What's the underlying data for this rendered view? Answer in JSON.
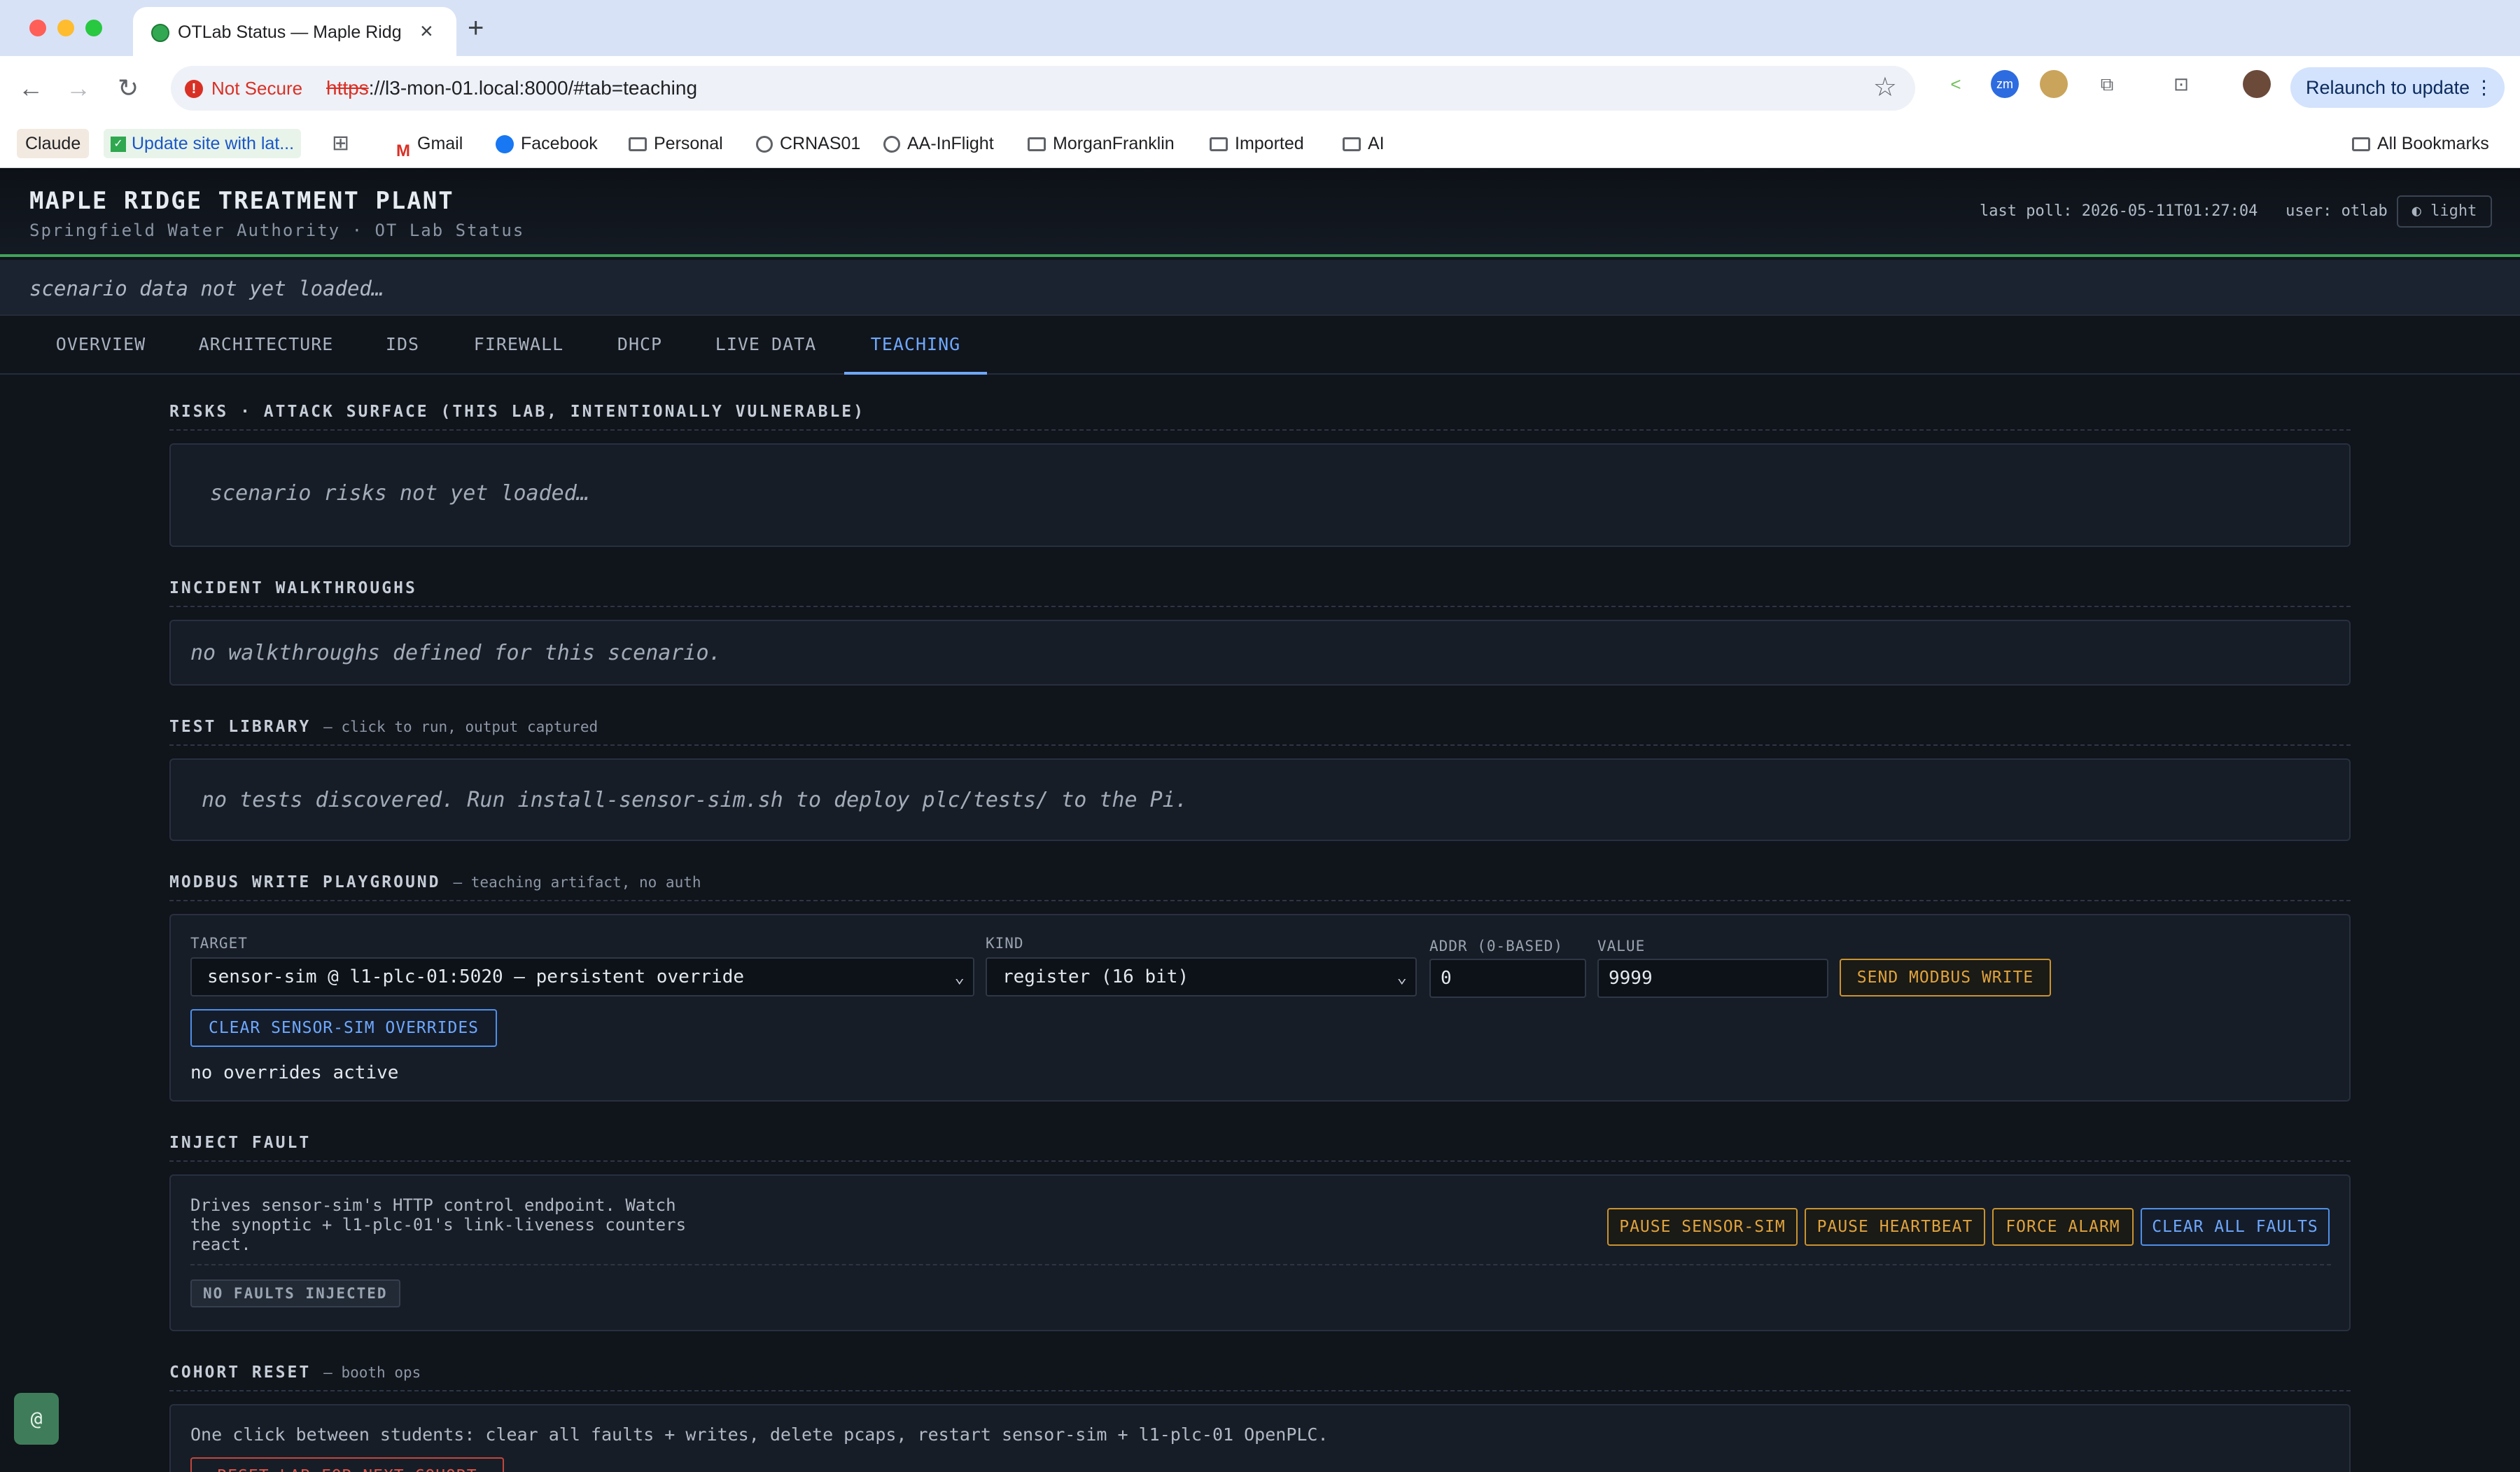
{
  "browser": {
    "tab_title": "OTLab Status — Maple Ridge",
    "tab_close": "×",
    "new_tab": "+",
    "not_secure": "Not Secure",
    "url_scheme": "https",
    "url_rest": "://l3-mon-01.local:8000/#tab=teaching",
    "relaunch": "Relaunch to update",
    "bookmarks": [
      {
        "label": "Claude"
      },
      {
        "label": "Update site with lat..."
      },
      {
        "label": "Gmail"
      },
      {
        "label": "Facebook"
      },
      {
        "label": "Personal"
      },
      {
        "label": "CRNAS01"
      },
      {
        "label": "AA-InFlight"
      },
      {
        "label": "MorganFranklin"
      },
      {
        "label": "Imported"
      },
      {
        "label": "AI"
      }
    ],
    "all_bookmarks": "All Bookmarks"
  },
  "header": {
    "title": "MAPLE RIDGE TREATMENT PLANT",
    "subtitle": "Springfield Water Authority · OT Lab Status",
    "last_poll": "last poll: 2026-05-11T01:27:04",
    "user": "user: otlab",
    "theme": "◐ light"
  },
  "scenario_message": "scenario data not yet loaded…",
  "tabs": [
    "OVERVIEW",
    "ARCHITECTURE",
    "IDS",
    "FIREWALL",
    "DHCP",
    "LIVE DATA",
    "TEACHING"
  ],
  "active_tab": "TEACHING",
  "sections": {
    "risks": {
      "title": "RISKS · ATTACK SURFACE (THIS LAB, INTENTIONALLY VULNERABLE)",
      "body": "scenario risks not yet loaded…"
    },
    "walkthroughs": {
      "title": "INCIDENT WALKTHROUGHS",
      "body": "no walkthroughs defined for this scenario."
    },
    "tests": {
      "title": "TEST LIBRARY",
      "note": "— click to run, output captured",
      "body": "no tests discovered. Run install-sensor-sim.sh to deploy plc/tests/ to the Pi."
    },
    "modbus": {
      "title": "MODBUS WRITE PLAYGROUND",
      "note": "— teaching artifact, no auth",
      "target_label": "TARGET",
      "target_value": "sensor-sim @ l1-plc-01:5020 — persistent override",
      "kind_label": "KIND",
      "kind_value": "register (16 bit)",
      "addr_label": "ADDR (0-BASED)",
      "addr_value": "0",
      "value_label": "VALUE",
      "value_value": "9999",
      "send_button": "SEND MODBUS WRITE",
      "clear_button": "CLEAR SENSOR-SIM OVERRIDES",
      "status": "no overrides active"
    },
    "fault": {
      "title": "INJECT FAULT",
      "desc_lines": [
        "Drives sensor-sim's HTTP control endpoint. Watch",
        "the synoptic + l1-plc-01's link-liveness counters",
        "react."
      ],
      "buttons": {
        "pause_sim": "PAUSE SENSOR-SIM",
        "pause_heartbeat": "PAUSE HEARTBEAT",
        "force_alarm": "FORCE ALARM",
        "clear_all": "CLEAR ALL FAULTS"
      },
      "status_badge": "NO FAULTS INJECTED"
    },
    "cohort": {
      "title": "COHORT RESET",
      "note": "— booth ops",
      "body": "One click between students: clear all faults + writes, delete pcaps, restart sensor-sim + l1-plc-01 OpenPLC.",
      "reset_button": "RESET LAB FOR NEXT COHORT"
    }
  },
  "float_button": "@"
}
